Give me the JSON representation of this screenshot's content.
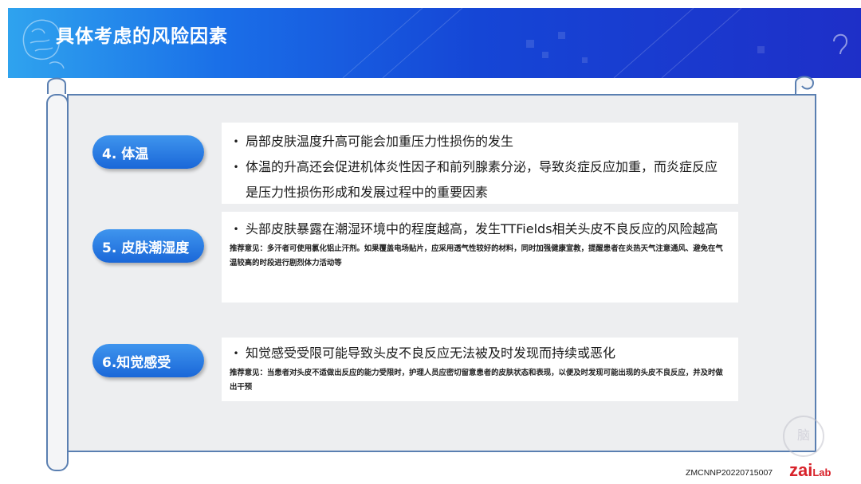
{
  "header": {
    "title": "具体考虑的风险因素"
  },
  "sections": [
    {
      "label": "4. 体温",
      "bullets": [
        "局部皮肤温度升高可能会加重压力性损伤的发生",
        "体温的升高还会促进机体炎性因子和前列腺素分泌，导致炎症反应加重，而炎症反应是压力性损伤形成和发展过程中的重要因素"
      ],
      "recommendation": ""
    },
    {
      "label": "5. 皮肤潮湿度",
      "bullets": [
        "头部皮肤暴露在潮湿环境中的程度越高，发生TTFields相关头皮不良反应的风险越高"
      ],
      "recommendation": "推荐意见：多汗者可使用氯化铝止汗剂。如果覆盖电场贴片，应采用透气性较好的材料，同时加强健康宣教，提醒患者在炎热天气注意通风、避免在气温较高的时段进行剧烈体力活动等"
    },
    {
      "label": "6.知觉感受",
      "bullets": [
        "知觉感受受限可能导致头皮不良反应无法被及时发现而持续或恶化"
      ],
      "recommendation": "推荐意见：当患者对头皮不适做出反应的能力受限时，护理人员应密切留意患者的皮肤状态和表现，以便及时发现可能出现的头皮不良反应，并及时做出干预"
    }
  ],
  "footer": {
    "code": "ZMCNNP20220715007",
    "logo_text": "zai",
    "logo_suffix": "Lab",
    "watermark": "脑"
  },
  "colors": {
    "banner_start": "#2fa3ee",
    "banner_end": "#1e2fc8",
    "label_blue": "#1a67d8",
    "scroll_border": "#5a7fb1",
    "logo_red": "#d8222a"
  }
}
